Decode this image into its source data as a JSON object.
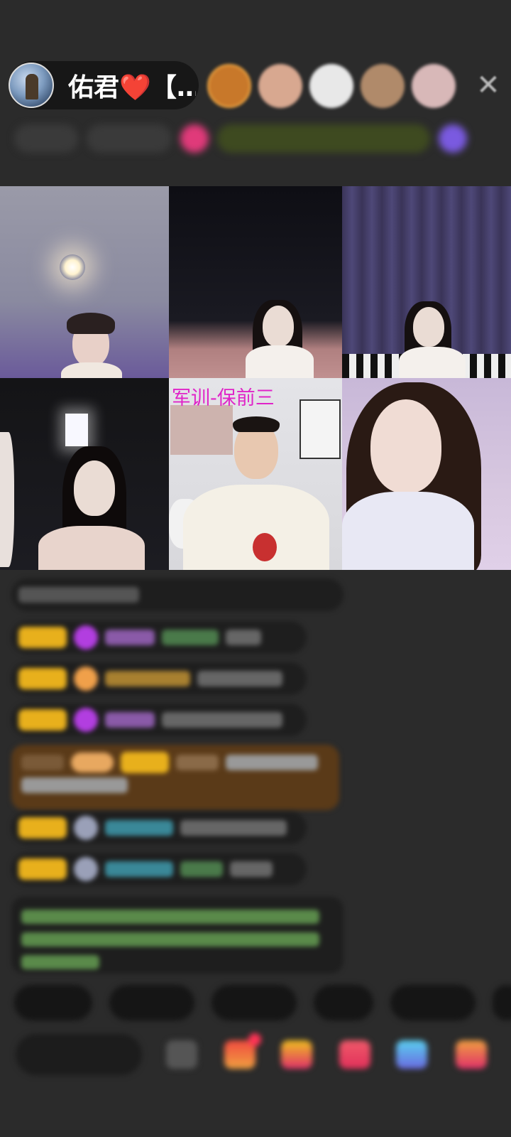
{
  "header": {
    "host_name": "佑君❤️【…",
    "close_icon": "close-icon",
    "viewer_avatar_colors": [
      "#c8782a",
      "#d8a890",
      "#e8e8e8",
      "#b08a6a",
      "#d8b8b8"
    ],
    "info_chips": [
      "",
      "",
      "",
      "",
      "",
      "",
      ""
    ]
  },
  "grid": {
    "tiles": [
      {
        "label": ""
      },
      {
        "label": ""
      },
      {
        "label": ""
      },
      {
        "label": ""
      },
      {
        "label": "军训-保前三"
      },
      {
        "label": ""
      }
    ]
  },
  "chat": {
    "messages": [
      "",
      "",
      "",
      "",
      "",
      "",
      "",
      ""
    ]
  },
  "quick_replies": [
    "",
    "",
    "",
    "",
    "",
    ""
  ],
  "bottom_bar": {
    "comment_placeholder": "",
    "icons": [
      "emoji-icon",
      "gift-box-icon",
      "treasure-icon",
      "heart-gift-icon",
      "game-icon",
      "more-gift-icon"
    ]
  }
}
